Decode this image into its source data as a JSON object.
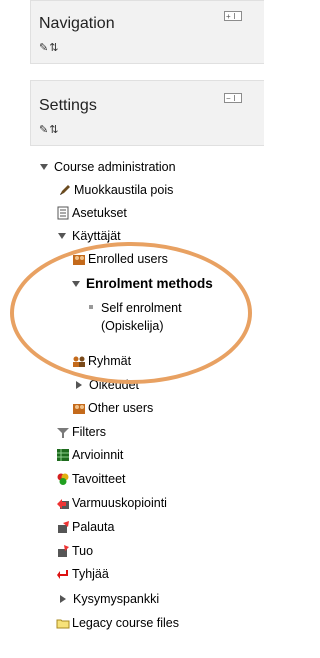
{
  "navigation": {
    "title": "Navigation"
  },
  "settings": {
    "title": "Settings"
  },
  "tree": {
    "course_admin": "Course administration",
    "muokkaustila": "Muokkaustila pois",
    "asetukset": "Asetukset",
    "kayttajat": "Käyttäjät",
    "enrolled_users": "Enrolled users",
    "enrolment_methods": "Enrolment methods",
    "self_enrolment_line1": "Self enrolment",
    "self_enrolment_line2": "(Opiskelija)",
    "ryhmat": "Ryhmät",
    "oikeudet": "Oikeudet",
    "other_users": "Other users",
    "filters": "Filters",
    "arvioinnit": "Arvioinnit",
    "tavoitteet": "Tavoitteet",
    "varmuuskopiointi": "Varmuuskopiointi",
    "palauta": "Palauta",
    "tuo": "Tuo",
    "tyhjaa": "Tyhjää",
    "kysymyspankki": "Kysymyspankki",
    "legacy": "Legacy course files"
  },
  "icons": {
    "accent_ellipse": "#e8a162"
  }
}
